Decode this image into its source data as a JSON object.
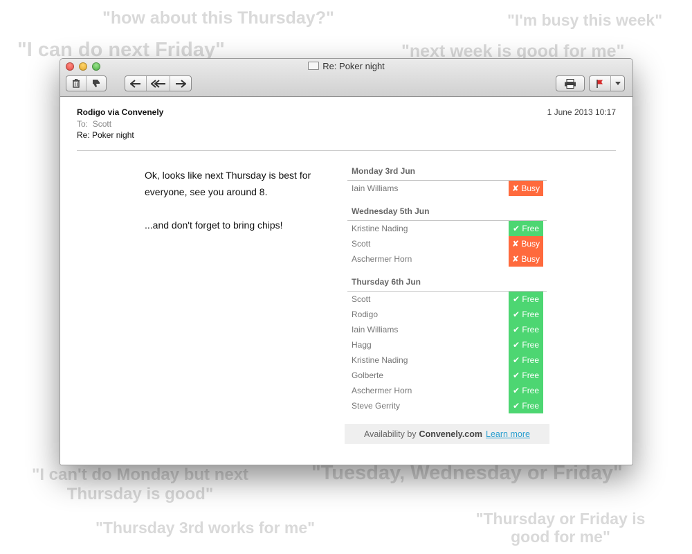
{
  "background_quotes": [
    "\"how about this Thursday?\"",
    "\"I'm busy this week\"",
    "\"I can do next Friday\"",
    "\"next week is good for me\"",
    "\"I can't do Monday but next Thursday is good\"",
    "\"Tuesday, Wednesday or Friday\"",
    "\"Thursday 3rd works for me\"",
    "\"Thursday or Friday is good for me\""
  ],
  "window": {
    "title": "Re: Poker night"
  },
  "toolbar": {
    "icons": [
      "trash-icon",
      "junk-icon",
      "reply-icon",
      "reply-all-icon",
      "forward-icon",
      "print-icon",
      "flag-icon"
    ]
  },
  "email": {
    "from": "Rodigo via Convenely",
    "to_label": "To:",
    "to": "Scott",
    "subject": "Re: Poker night",
    "date": "1 June 2013 10:17",
    "paragraph1": "Ok, looks like next Thursday is best for everyone, see you around 8.",
    "paragraph2": "...and don't forget to bring chips!"
  },
  "availability": [
    {
      "day": "Monday 3rd Jun",
      "people": [
        {
          "name": "Iain Williams",
          "status": "✘ Busy"
        }
      ]
    },
    {
      "day": "Wednesday 5th Jun",
      "people": [
        {
          "name": "Kristine Nading",
          "status": "✔ Free"
        },
        {
          "name": "Scott",
          "status": "✘ Busy"
        },
        {
          "name": "Aschermer Horn",
          "status": "✘ Busy"
        }
      ]
    },
    {
      "day": "Thursday 6th Jun",
      "people": [
        {
          "name": "Scott",
          "status": "✔ Free"
        },
        {
          "name": "Rodigo",
          "status": "✔ Free"
        },
        {
          "name": "Iain Williams",
          "status": "✔ Free"
        },
        {
          "name": "Hagg",
          "status": "✔ Free"
        },
        {
          "name": "Kristine Nading",
          "status": "✔ Free"
        },
        {
          "name": "Golberte",
          "status": "✔ Free"
        },
        {
          "name": "Aschermer Horn",
          "status": "✔ Free"
        },
        {
          "name": "Steve Gerrity",
          "status": "✔ Free"
        }
      ]
    }
  ],
  "footer": {
    "prefix": "Availability by",
    "brand": "Convenely.com",
    "link": "Learn more"
  },
  "colors": {
    "busy": "#ff6a3d",
    "free": "#4dd672",
    "link": "#2a9fd0"
  }
}
